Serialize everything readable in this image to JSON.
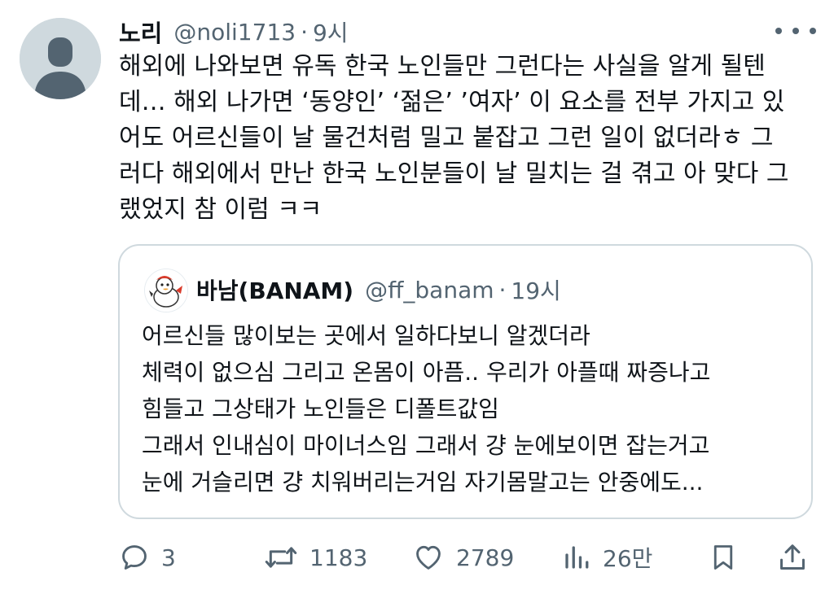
{
  "tweet": {
    "author_name": "노리",
    "author_handle": "@noli1713",
    "time": "9시",
    "text_lines": [
      "해외에 나와보면 유독 한국 노인들만 그런다는 사실을 알게 될텐",
      "데… 해외 나가면 ‘동양인’ ‘젊은’ ’여자’ 이 요소를 전부 가지고 있",
      "어도 어르신들이 날 물건처럼 밀고 붙잡고 그런 일이 없더라ㅎ 그",
      "러다 해외에서 만난 한국 노인분들이 날 밀치는 걸 겪고 아 맞다 그",
      "랬었지 참 이럼 ㅋㅋ"
    ]
  },
  "quote": {
    "author_name": "바남(BANAM)",
    "author_handle": "@ff_banam",
    "time": "19시",
    "text_lines": [
      "어르신들 많이보는 곳에서 일하다보니 알겠더라",
      "체력이 없으심 그리고 온몸이 아픔.. 우리가 아플때 짜증나고",
      "힘들고 그상태가 노인들은 디폴트값임",
      "그래서 인내심이 마이너스임 그래서 걍 눈에보이면 잡는거고",
      "눈에 거슬리면 걍 치워버리는거임 자기몸말고는 안중에도..."
    ]
  },
  "actions": {
    "replies": "3",
    "retweets": "1183",
    "likes": "2789",
    "views": "26만"
  },
  "icons": {
    "reply": "speech-bubble-icon",
    "retweet": "retweet-arrows-icon",
    "like": "heart-icon",
    "views": "bar-chart-icon",
    "bookmark": "bookmark-icon",
    "share": "share-upload-icon",
    "more": "more-dots-icon"
  },
  "colors": {
    "text_primary": "#0f1419",
    "text_secondary": "#536471",
    "border": "#cfd9de",
    "avatar_placeholder": "#cfd9de"
  }
}
